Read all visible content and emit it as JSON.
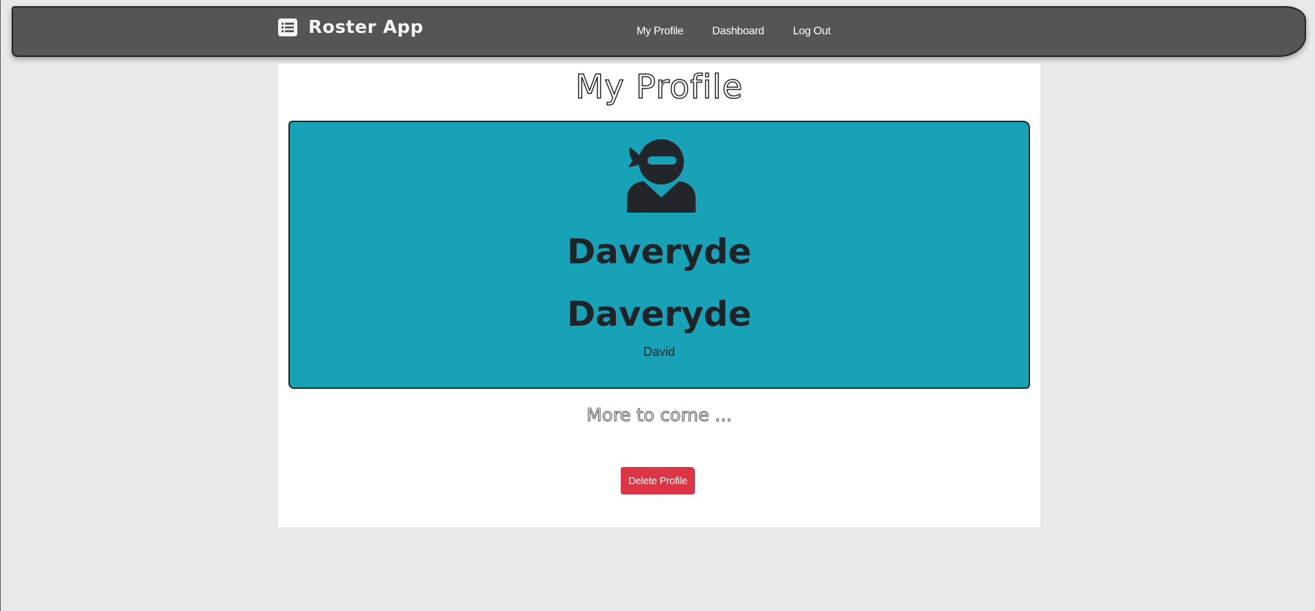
{
  "navbar": {
    "brand": "Roster App",
    "brand_icon": "list-icon",
    "links": [
      "My Profile",
      "Dashboard",
      "Log Out"
    ]
  },
  "page": {
    "title": "My Profile"
  },
  "profile": {
    "avatar_icon": "user-ninja-icon",
    "name_line_1": "Daveryde",
    "name_line_2": "Daveryde",
    "first_name": "David",
    "card_color": "#17a2b8"
  },
  "footer_text": "More to come ...",
  "actions": {
    "delete_label": "Delete Profile",
    "delete_color": "#dc3545"
  }
}
